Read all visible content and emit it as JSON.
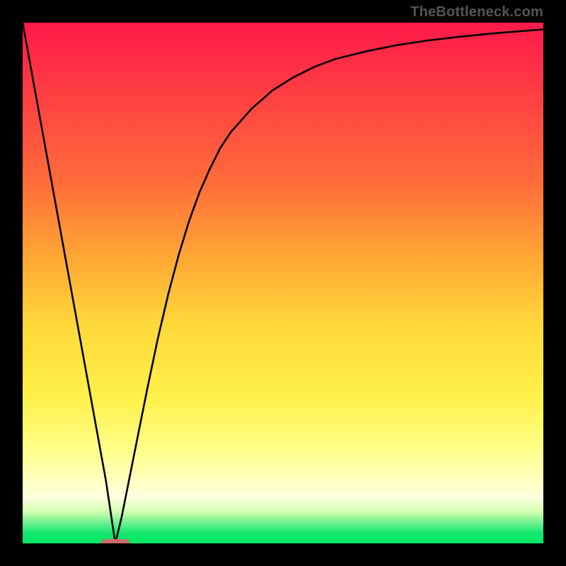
{
  "watermark": {
    "text": "TheBottleneck.com"
  },
  "colors": {
    "frame": "#000000",
    "curve": "#000000",
    "marker": "#cc6a6a",
    "gradient_stops": [
      "#ff1a4a",
      "#ff3a44",
      "#ff6a3a",
      "#ffa634",
      "#ffd83a",
      "#fff04a",
      "#ffff8a",
      "#ffffc0",
      "#ffffe0",
      "#d0ffb0",
      "#70f090",
      "#16e870",
      "#00e860"
    ]
  },
  "chart_data": {
    "type": "line",
    "title": "",
    "xlabel": "",
    "ylabel": "",
    "xlim": [
      0,
      100
    ],
    "ylim": [
      0,
      100
    ],
    "grid": false,
    "legend": false,
    "series": [
      {
        "name": "curve",
        "x": [
          0,
          2,
          4,
          6,
          8,
          10,
          12,
          14,
          16,
          17.8,
          19,
          20,
          22,
          24,
          26,
          28,
          30,
          32,
          34,
          36,
          38,
          40,
          44,
          48,
          52,
          56,
          60,
          66,
          72,
          78,
          84,
          90,
          96,
          100
        ],
        "y": [
          100,
          89,
          78,
          67,
          56,
          45,
          34,
          23,
          12,
          0,
          5,
          10,
          20,
          30,
          39.5,
          48,
          55.5,
          62,
          67.5,
          72,
          76,
          79,
          83.5,
          87,
          89.5,
          91.5,
          93,
          94.5,
          95.7,
          96.6,
          97.3,
          97.9,
          98.4,
          98.7
        ]
      }
    ],
    "marker": {
      "name": "min-marker",
      "x_center": 17.8,
      "y": 0,
      "width_x_units": 5.5
    }
  }
}
